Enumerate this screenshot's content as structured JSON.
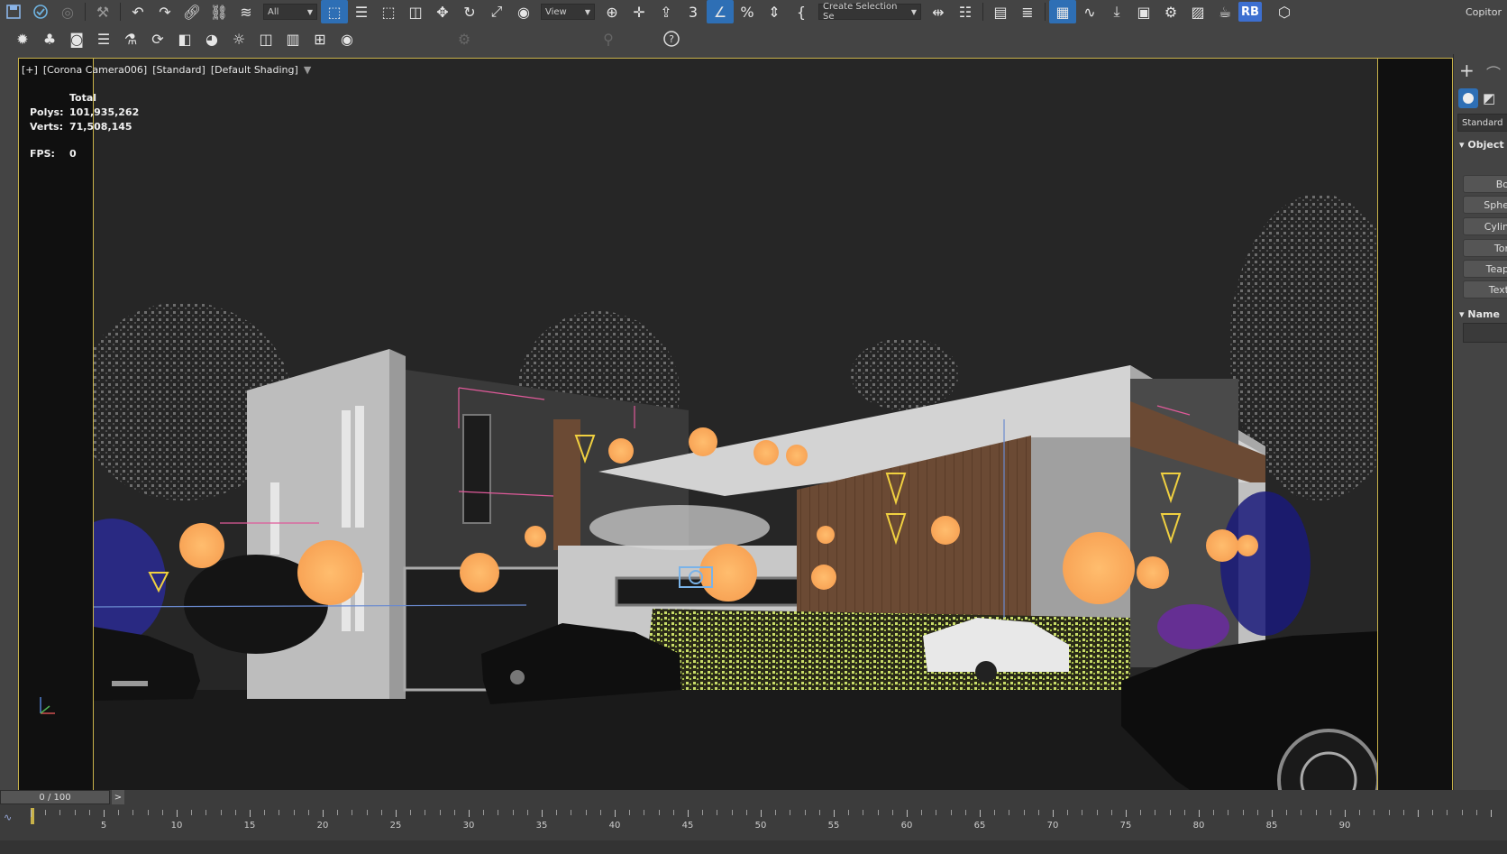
{
  "toolbar_main": {
    "selection_filter": "All",
    "reference_coord": "View",
    "named_selection": "Create Selection Se",
    "rb_label": "RB",
    "right_label": "Copitor"
  },
  "viewport": {
    "label_plus": "[+]",
    "label_camera": "[Corona Camera006]",
    "label_standard": "[Standard]",
    "label_shading": "[Default Shading]",
    "stats": {
      "header": "Total",
      "polys_label": "Polys:",
      "polys_value": "101,935,262",
      "verts_label": "Verts:",
      "verts_value": "71,508,145",
      "fps_label": "FPS:",
      "fps_value": "0"
    }
  },
  "command_panel": {
    "category": "Standard",
    "rollout_object": "Object",
    "buttons": [
      "Bo",
      "Sphe",
      "Cylin",
      "Tor",
      "Teap",
      "Text"
    ],
    "rollout_name": "Name"
  },
  "timeline": {
    "frame_display": "0 / 100",
    "next_label": ">",
    "tick_labels": [
      "5",
      "10",
      "15",
      "20",
      "25",
      "30",
      "35",
      "40",
      "45",
      "50",
      "55",
      "60",
      "65",
      "70",
      "75",
      "80",
      "85",
      "90"
    ],
    "total_frames": 100,
    "current_frame": 0
  },
  "colors": {
    "accent_yellow": "#c8b24a",
    "active_blue": "#2e6fb5",
    "light_orange": "#f8b36a"
  }
}
